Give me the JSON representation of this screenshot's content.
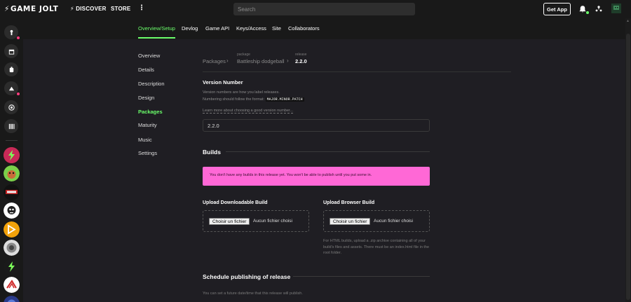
{
  "topnav": {
    "logo": "GAME JOLT",
    "discover": "DISCOVER",
    "store": "STORE",
    "more": "⋮",
    "search_placeholder": "Search",
    "get_app": "Get App"
  },
  "tabs": [
    "Overview/Setup",
    "Devlog",
    "Game API",
    "Keys/Access",
    "Site",
    "Collaborators"
  ],
  "menu": [
    "Overview",
    "Details",
    "Description",
    "Design",
    "Packages",
    "Maturity",
    "Music",
    "Settings"
  ],
  "breadcrumb": {
    "root": "Packages",
    "package_label": "package",
    "package_name": "Battleship dodgeball",
    "release_label": "release",
    "release_name": "2.2.0"
  },
  "version": {
    "title": "Version Number",
    "help_line1": "Version numbers are how you label releases.",
    "help_line2": "Numbering should follow the format:",
    "format": "MAJOR.MINOR.PATCH",
    "learn_more": "Learn more about choosing a good version number...",
    "value": "2.2.0"
  },
  "builds": {
    "title": "Builds",
    "alert": "You don't have any builds in this release yet. You won't be able to publish until you put some in.",
    "downloadable_title": "Upload Downloadable Build",
    "browser_title": "Upload Browser Build",
    "choose_file": "Choisir un fichier",
    "no_file": "Aucun fichier choisi",
    "browser_help": "For HTML builds, upload a .zip archive containing all of your build's files and assets. There must be an index.html file in the root folder."
  },
  "schedule": {
    "title": "Schedule publishing of release",
    "help": "You can set a future date/time that this release will publish."
  },
  "colors": {
    "accent": "#6bff6b",
    "alert_bg": "#ff68d6",
    "notify_dot": "#ff3e7f"
  }
}
